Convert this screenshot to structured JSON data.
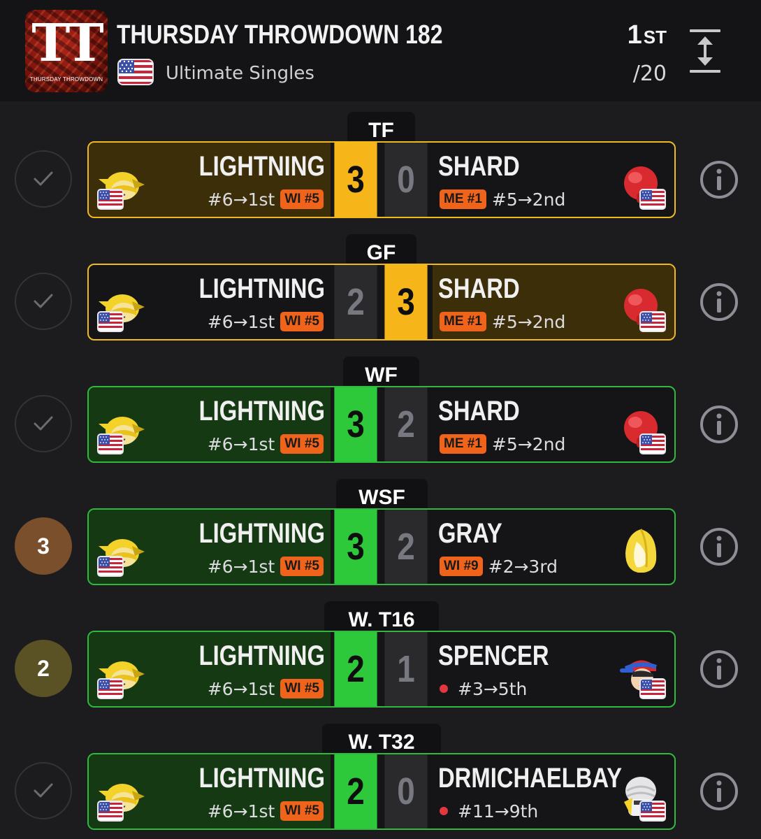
{
  "header": {
    "logo_text": "TT",
    "logo_subtitle": "THURSDAY THROWDOWN",
    "event_title": "THURSDAY THROWDOWN 182",
    "event_subtitle": "Ultimate Singles",
    "placing_number": "1",
    "placing_suffix": "ST",
    "total_entrants": "/20"
  },
  "colors": {
    "background": "#1c1c1e",
    "gold_win": "#f6b619",
    "green_win": "#2ec83b",
    "tag_orange": "#f0631a",
    "bronze_badge": "#7a4f2b",
    "olive_badge": "#5a5125"
  },
  "matches": [
    {
      "round": "TF",
      "outcome": "check",
      "highlight": "gold",
      "winner_side": "left",
      "left": {
        "name": "LIGHTNING",
        "seed": "#6→1st",
        "tag": "WI #5",
        "score": "3",
        "avatar_icon": "toon-link-icon"
      },
      "right": {
        "name": "SHARD",
        "seed": "#5→2nd",
        "tag": "ME #1",
        "score": "0",
        "avatar_icon": "boxing-glove-icon"
      }
    },
    {
      "round": "GF",
      "outcome": "check",
      "highlight": "gold",
      "winner_side": "right",
      "left": {
        "name": "LIGHTNING",
        "seed": "#6→1st",
        "tag": "WI #5",
        "score": "2",
        "avatar_icon": "toon-link-icon"
      },
      "right": {
        "name": "SHARD",
        "seed": "#5→2nd",
        "tag": "ME #1",
        "score": "3",
        "avatar_icon": "boxing-glove-icon"
      }
    },
    {
      "round": "WF",
      "outcome": "check",
      "highlight": "green",
      "winner_side": "left",
      "left": {
        "name": "LIGHTNING",
        "seed": "#6→1st",
        "tag": "WI #5",
        "score": "3",
        "avatar_icon": "toon-link-icon"
      },
      "right": {
        "name": "SHARD",
        "seed": "#5→2nd",
        "tag": "ME #1",
        "score": "2",
        "avatar_icon": "boxing-glove-icon"
      }
    },
    {
      "round": "WSF",
      "outcome": "3",
      "highlight": "green",
      "winner_side": "left",
      "left": {
        "name": "LIGHTNING",
        "seed": "#6→1st",
        "tag": "WI #5",
        "score": "3",
        "avatar_icon": "toon-link-icon"
      },
      "right": {
        "name": "GRAY",
        "seed": "#2→3rd",
        "tag": "WI #9",
        "score": "2",
        "avatar_icon": "samus-blonde-icon"
      }
    },
    {
      "round": "W. T16",
      "outcome": "2",
      "highlight": "green",
      "winner_side": "left",
      "left": {
        "name": "LIGHTNING",
        "seed": "#6→1st",
        "tag": "WI #5",
        "score": "2",
        "avatar_icon": "toon-link-icon"
      },
      "right": {
        "name": "SPENCER",
        "seed": "#3→5th",
        "tag": "",
        "score": "1",
        "avatar_icon": "ness-icon"
      }
    },
    {
      "round": "W. T32",
      "outcome": "check",
      "highlight": "green",
      "winner_side": "left",
      "left": {
        "name": "LIGHTNING",
        "seed": "#6→1st",
        "tag": "WI #5",
        "score": "2",
        "avatar_icon": "toon-link-icon"
      },
      "right": {
        "name": "DRMICHAELBAY",
        "seed": "#11→9th",
        "tag": "",
        "score": "0",
        "avatar_icon": "sheik-icon"
      }
    }
  ]
}
